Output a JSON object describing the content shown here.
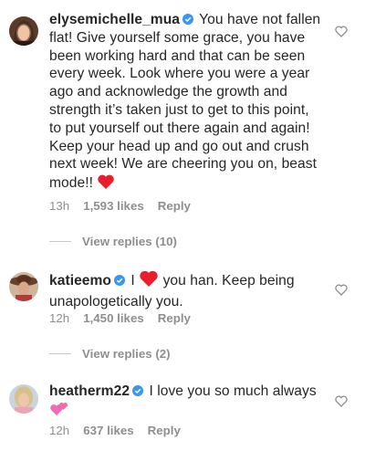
{
  "comments": [
    {
      "username": "elysemichelle_mua",
      "text": "You have not fallen flat! Give yourself some grace, you have been working hard and that can be seen every week. Look where you were a year ago and acknowledge the growth and strength it’s taken just to get to this point, to put yourself out there again and again! Keep your head up and go out and crush next week! We are cheering you on, beast mode!!",
      "emoji": "red-heart-emoji",
      "time": "13h",
      "likes": "1,593 likes",
      "reply_label": "Reply",
      "verified": true
    },
    {
      "username": "katieemo",
      "text_before": "I",
      "emoji": "red-heart-emoji",
      "text_after": "you han. Keep being unapologetically you.",
      "time": "12h",
      "likes": "1,450 likes",
      "reply_label": "Reply",
      "verified": true
    },
    {
      "username": "heatherm22",
      "text": "I love you so much always",
      "emoji": "two-hearts-emoji",
      "time": "12h",
      "likes": "637 likes",
      "reply_label": "Reply",
      "verified": true
    }
  ],
  "view_replies": [
    {
      "label": "View replies (10)"
    },
    {
      "label": "View replies (2)"
    }
  ],
  "colors": {
    "text": "#262626",
    "meta": "#8e8e8e",
    "verified_blue": "#3897f0",
    "heart_red": "#ed4956",
    "two_hearts_pink": "#f06bb5"
  }
}
